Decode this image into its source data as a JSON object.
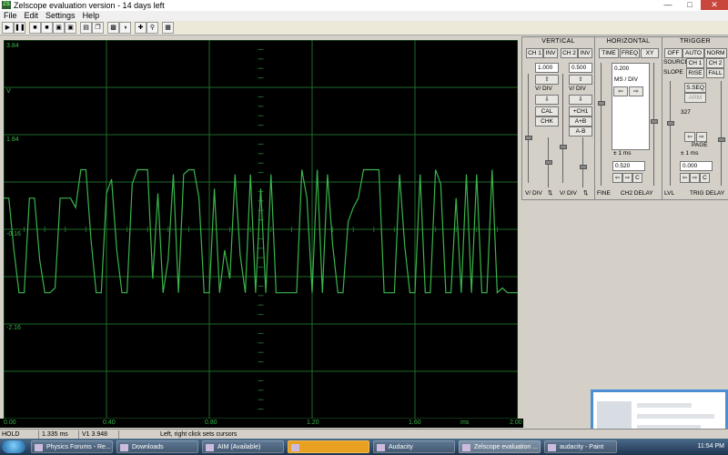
{
  "window": {
    "title": "Zelscope evaluation version - 14 days left",
    "app_icon": "ZS"
  },
  "menu": [
    "File",
    "Edit",
    "Settings",
    "Help"
  ],
  "toolbar": {
    "buttons": [
      "play-icon",
      "pause-icon",
      "save-icon",
      "save-icon",
      "save-icon",
      "save-icon",
      "print-icon",
      "copy-icon",
      "paste-icon",
      "color-icon",
      "trace-icon",
      "crosshair-icon",
      "zoom-icon",
      "grid-icon"
    ]
  },
  "scope": {
    "y_labels": [
      "3.84",
      "V",
      "1.84",
      "-0.16",
      "-2.16"
    ],
    "x_labels": [
      "0.00",
      "0.40",
      "0.80",
      "1.20",
      "1.60",
      "ms",
      "2.00"
    ],
    "trace_color": "#39b54a",
    "grid_color": "#1f6a2a",
    "waveform": {
      "x_range": [
        0,
        2
      ],
      "y_range": [
        -4.16,
        3.84
      ],
      "x": [
        0.0,
        0.02,
        0.04,
        0.06,
        0.08,
        0.1,
        0.12,
        0.14,
        0.16,
        0.18,
        0.2,
        0.22,
        0.24,
        0.26,
        0.28,
        0.3,
        0.32,
        0.34,
        0.36,
        0.38,
        0.4,
        0.42,
        0.44,
        0.46,
        0.48,
        0.5,
        0.52,
        0.54,
        0.56,
        0.58,
        0.6,
        0.62,
        0.64,
        0.66,
        0.68,
        0.7,
        0.72,
        0.74,
        0.76,
        0.78,
        0.8,
        0.82,
        0.84,
        0.86,
        0.88,
        0.9,
        0.92,
        0.94,
        0.96,
        0.98,
        1.0,
        1.02,
        1.04,
        1.06,
        1.08,
        1.1,
        1.12,
        1.14,
        1.16,
        1.18,
        1.2,
        1.22,
        1.24,
        1.26,
        1.28,
        1.3,
        1.32,
        1.34,
        1.36,
        1.38,
        1.4,
        1.42,
        1.44,
        1.46,
        1.48,
        1.5,
        1.52,
        1.54,
        1.56,
        1.58,
        1.6,
        1.62,
        1.64,
        1.66,
        1.68,
        1.7,
        1.72,
        1.74,
        1.76,
        1.78,
        1.8,
        1.82,
        1.84,
        1.86,
        1.88,
        1.9,
        1.92,
        1.94,
        1.96,
        1.98,
        2.0
      ],
      "y": [
        0.5,
        0.5,
        -0.6,
        -1.5,
        -1.5,
        0.5,
        0.5,
        -0.8,
        -1.5,
        -1.5,
        -1.4,
        0.5,
        0.5,
        0.5,
        0.3,
        1.1,
        1.1,
        -0.4,
        -1.5,
        -1.5,
        0.6,
        0.9,
        -0.6,
        -1.5,
        -1.5,
        0.8,
        1.1,
        1.1,
        1.1,
        -1.2,
        0.6,
        -1.5,
        -0.8,
        1.0,
        -1.5,
        1.0,
        1.1,
        1.1,
        0.5,
        -1.5,
        -1.5,
        0.7,
        -1.5,
        -0.6,
        -1.2,
        1.0,
        -0.7,
        -1.5,
        1.0,
        -1.5,
        0.7,
        -1.5,
        1.0,
        -1.5,
        -1.5,
        -1.5,
        -1.5,
        -1.5,
        1.1,
        0.5,
        -1.5,
        1.1,
        -1.5,
        1.0,
        -0.5,
        -1.5,
        -1.5,
        0.0,
        0.3,
        0.5,
        1.1,
        1.1,
        1.1,
        1.1,
        -1.5,
        -1.5,
        -1.5,
        1.0,
        -0.5,
        -1.5,
        -1.5,
        1.0,
        -1.5,
        -1.5,
        1.1,
        0.8,
        -1.5,
        -1.5,
        0.5,
        -1.5,
        1.0,
        -1.5,
        1.0,
        -1.5,
        -1.5,
        1.1,
        -1.5,
        -1.4,
        -1.5,
        -1.5,
        -1.5
      ]
    }
  },
  "vertical": {
    "title": "VERTICAL",
    "ch1": "CH 1",
    "inv1": "INV",
    "ch2": "CH 2",
    "inv2": "INV",
    "ch1_value": "1.000",
    "ch2_value": "0.500",
    "vdiv1": "V/ DIV",
    "vdiv2": "V/ DIV",
    "cal": "CAL",
    "chk": "CHK",
    "plus_ch1": "+CH1",
    "a_plus_b": "A+B",
    "a_minus_b": "A-B",
    "footer1": "V/ DIV",
    "footer2": "V/ DIV"
  },
  "horizontal": {
    "title": "HORIZONTAL",
    "time": "TIME",
    "freq": "FREQ",
    "xy": "XY",
    "value": "0.200",
    "unit": "MS / DIV",
    "delay_unit": "± 1 ms",
    "delay_value": "0.520",
    "c_label": "C",
    "fine": "FINE",
    "ch2_delay": "CH2 DELAY"
  },
  "trigger": {
    "title": "TRIGGER",
    "off": "OFF",
    "auto": "AUTO",
    "norm": "NORM",
    "source": "SOURCE",
    "ch1": "CH 1",
    "ch2": "CH 2",
    "slope": "SLOPE",
    "rise": "RISE",
    "fall": "FALL",
    "sseq": "S.SEQ",
    "arm": "ARM",
    "level_value": "327",
    "page": "PAGE",
    "delay_unit": "± 1 ms",
    "delay_value": "0.000",
    "c_label": "C",
    "lvl": "LVL",
    "trig_delay": "TRIG DELAY"
  },
  "status": {
    "mode": "HOLD",
    "time": "1.335 ms",
    "value": "V1 3.948",
    "hint": "Left, right click sets cursors"
  },
  "taskbar": {
    "items": [
      "Physics Forums - Re...",
      "Downloads",
      "AIM (Available)",
      "",
      "Audacity",
      "Zelscope evaluation ...",
      "audacity - Paint"
    ],
    "clock": "11:54 PM"
  }
}
